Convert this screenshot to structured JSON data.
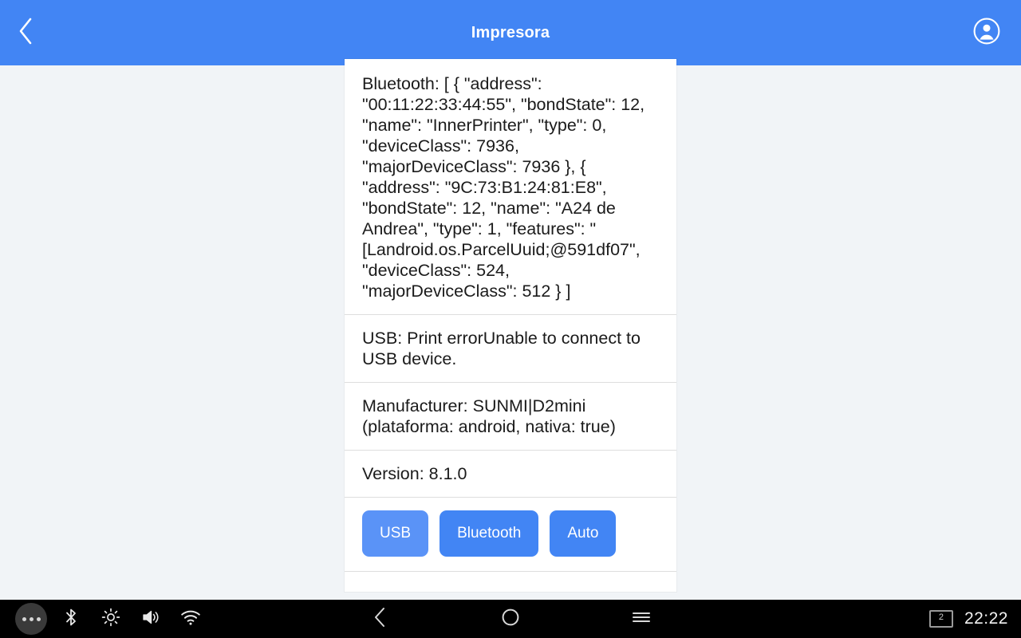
{
  "appbar": {
    "title": "Impresora",
    "back_icon": "chevron-left-icon",
    "account_icon": "account-circle-icon",
    "background_color": "#4285f4",
    "text_color": "#ffffff"
  },
  "card": {
    "rows": [
      {
        "id": "bluetooth",
        "text": "Bluetooth: [ { \"address\": \"00:11:22:33:44:55\", \"bondState\": 12, \"name\": \"InnerPrinter\", \"type\": 0, \"deviceClass\": 7936, \"majorDeviceClass\": 7936 }, { \"address\": \"9C:73:B1:24:81:E8\", \"bondState\": 12, \"name\": \"A24 de Andrea\", \"type\": 1, \"features\": \"[Landroid.os.ParcelUuid;@591df07\", \"deviceClass\": 524, \"majorDeviceClass\": 512 } ]"
      },
      {
        "id": "usb",
        "text": "USB: Print errorUnable to connect to USB device."
      },
      {
        "id": "manufacturer",
        "text": "Manufacturer: SUNMI|D2mini (plataforma: android, nativa: true)"
      },
      {
        "id": "version",
        "text": "Version: 8.1.0"
      }
    ],
    "buttons": [
      {
        "id": "usb",
        "label": "USB"
      },
      {
        "id": "bluetooth",
        "label": "Bluetooth"
      },
      {
        "id": "auto",
        "label": "Auto"
      }
    ],
    "button_color": "#4285f4",
    "background_color": "#ffffff",
    "divider_color": "#dedede"
  },
  "page": {
    "background_color": "#f1f4f7"
  },
  "systembar": {
    "background_color": "#000000",
    "tray_icons": [
      {
        "name": "more-options-icon",
        "label": "more"
      },
      {
        "name": "bluetooth-icon",
        "label": "Bluetooth"
      },
      {
        "name": "brightness-icon",
        "label": "Brightness"
      },
      {
        "name": "volume-icon",
        "label": "Volume"
      },
      {
        "name": "wifi-icon",
        "label": "Wi-Fi"
      }
    ],
    "nav_icons": [
      {
        "name": "nav-back-icon",
        "label": "Back"
      },
      {
        "name": "nav-home-icon",
        "label": "Home"
      },
      {
        "name": "nav-recents-icon",
        "label": "Recents"
      }
    ],
    "notification_count": "2",
    "clock": "22:22"
  }
}
